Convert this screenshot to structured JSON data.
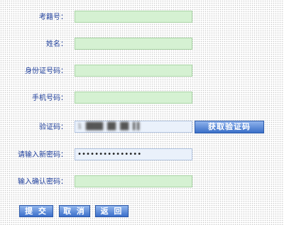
{
  "form": {
    "exam_number": {
      "label": "考籍号：",
      "value": ""
    },
    "name": {
      "label": "姓名：",
      "value": ""
    },
    "id_number": {
      "label": "身份证号码：",
      "value": ""
    },
    "phone": {
      "label": "手机号码：",
      "value": ""
    },
    "verification": {
      "label": "验证码：",
      "value": "1 ████ ██ ██ ▌▌",
      "button": "获取验证码"
    },
    "new_password": {
      "label": "请输入新密码：",
      "value": "•••••••••••••••"
    },
    "confirm_password": {
      "label": "输入确认密码：",
      "value": ""
    }
  },
  "actions": {
    "submit": "提 交",
    "cancel": "取 消",
    "back": "返 回"
  },
  "colors": {
    "label_text": "#1f3f9c",
    "field_green": "#d5f1d2",
    "field_blue": "#eaf1fb",
    "button_blue": "#3b6fca"
  }
}
